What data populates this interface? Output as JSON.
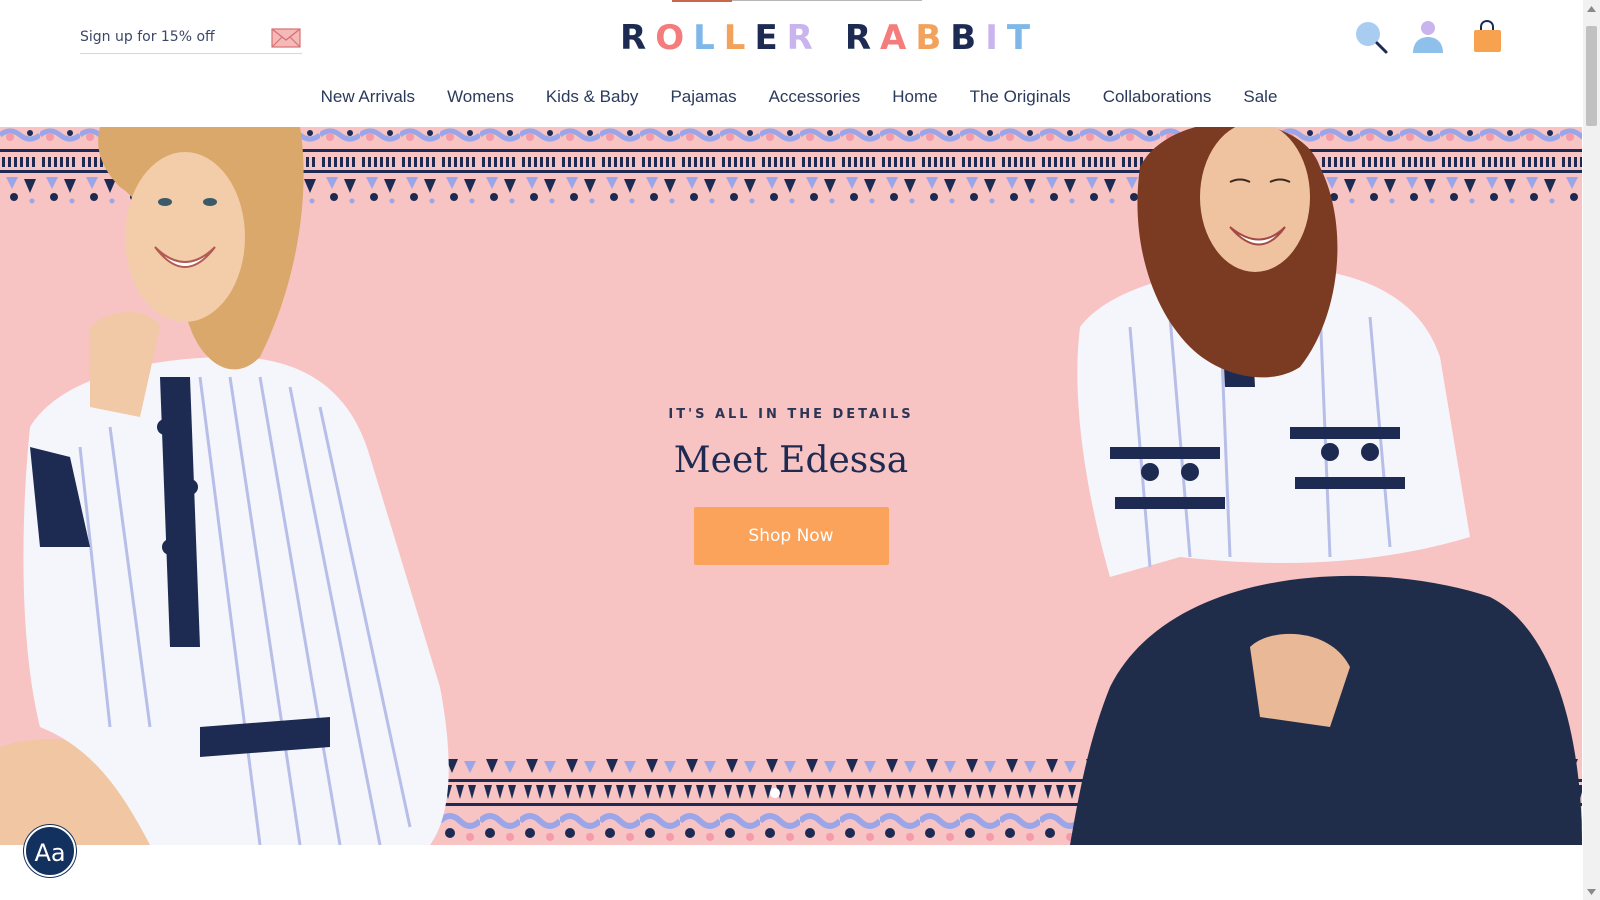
{
  "header": {
    "signup_placeholder": "Sign up for 15% off",
    "logo_letters": [
      {
        "char": "R",
        "color": "#1d2b52"
      },
      {
        "char": "O",
        "color": "#f47c7c"
      },
      {
        "char": "L",
        "color": "#7fb8e8"
      },
      {
        "char": "L",
        "color": "#f3a25b"
      },
      {
        "char": "E",
        "color": "#1d2b52"
      },
      {
        "char": "R",
        "color": "#c9b4ee"
      },
      {
        "char": "R",
        "color": "#1d2b52"
      },
      {
        "char": "A",
        "color": "#f47c7c"
      },
      {
        "char": "B",
        "color": "#f3a25b"
      },
      {
        "char": "B",
        "color": "#1d2b52"
      },
      {
        "char": "I",
        "color": "#c9b4ee"
      },
      {
        "char": "T",
        "color": "#7fb8e8"
      }
    ],
    "icons": {
      "mail": "envelope-icon",
      "search": "search-icon",
      "account": "user-icon",
      "cart": "shopping-bag-icon"
    }
  },
  "nav": {
    "items": [
      "New Arrivals",
      "Womens",
      "Kids & Baby",
      "Pajamas",
      "Accessories",
      "Home",
      "The Originals",
      "Collaborations",
      "Sale"
    ]
  },
  "hero": {
    "eyebrow": "IT'S ALL IN THE DETAILS",
    "headline": "Meet Edessa",
    "cta_label": "Shop Now",
    "slides_total": 1,
    "active_slide": 1
  },
  "accessibility": {
    "font_button_label": "Aa"
  },
  "colors": {
    "hero_background": "#f8c3c3",
    "navy": "#1d2b52",
    "cta_orange": "#fba35a",
    "pattern_blue": "#9aa6e8",
    "pattern_pink": "#f59aa8"
  }
}
